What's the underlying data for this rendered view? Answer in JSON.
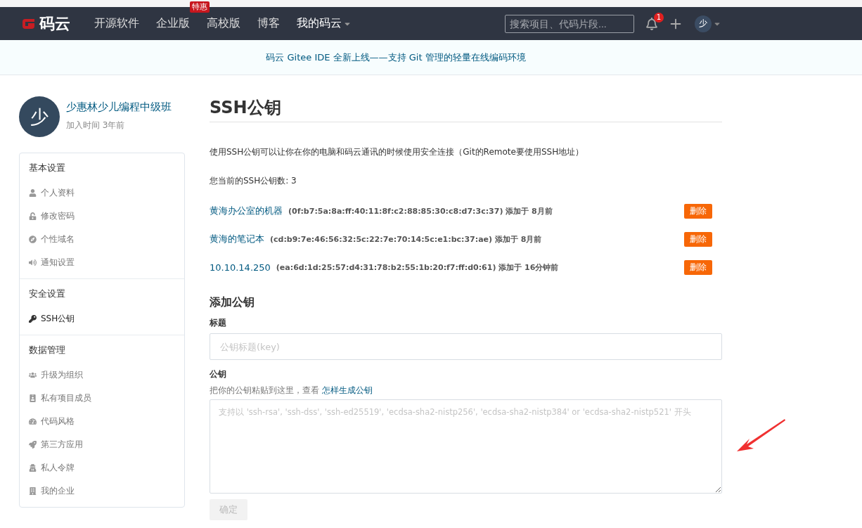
{
  "navbar": {
    "logo_text": "码云",
    "links": [
      {
        "label": "开源软件"
      },
      {
        "label": "企业版",
        "badge": "特惠"
      },
      {
        "label": "高校版"
      },
      {
        "label": "博客"
      }
    ],
    "my_menu": {
      "label": "我的码云"
    },
    "search": {
      "placeholder": "搜索项目、代码片段..."
    },
    "notification_count": "1",
    "avatar_text": "少"
  },
  "banner": {
    "text": "码云 Gitee IDE 全新上线——支持 Git 管理的轻量在线编码环境"
  },
  "profile": {
    "avatar_text": "少",
    "name": "少惠林少儿编程中级班",
    "joined": "加入时间 3年前"
  },
  "sidebar": {
    "sections": [
      {
        "title": "基本设置",
        "items": [
          {
            "label": "个人资料",
            "selected": false
          },
          {
            "label": "修改密码",
            "selected": false
          },
          {
            "label": "个性域名",
            "selected": false
          },
          {
            "label": "通知设置",
            "selected": false
          }
        ]
      },
      {
        "title": "安全设置",
        "items": [
          {
            "label": "SSH公钥",
            "selected": true
          }
        ]
      },
      {
        "title": "数据管理",
        "items": [
          {
            "label": "升级为组织",
            "selected": false
          },
          {
            "label": "私有项目成员",
            "selected": false
          },
          {
            "label": "代码风格",
            "selected": false
          },
          {
            "label": "第三方应用",
            "selected": false
          },
          {
            "label": "私人令牌",
            "selected": false
          },
          {
            "label": "我的企业",
            "selected": false
          }
        ]
      }
    ]
  },
  "main": {
    "title": "SSH公钥",
    "description": "使用SSH公钥可以让你在你的电脑和码云通讯的时候使用安全连接（Git的Remote要使用SSH地址）",
    "count_text": "您当前的SSH公钥数: 3",
    "keys": [
      {
        "name": "黄海办公室的机器",
        "fingerprint": "(0f:b7:5a:8a:ff:40:11:8f:c2:88:85:30:c8:d7:3c:37) 添加于 8月前",
        "delete_label": "删除"
      },
      {
        "name": "黄海的笔记本",
        "fingerprint": "(cd:b9:7e:46:56:32:5c:22:7e:70:14:5c:e1:bc:37:ae) 添加于 8月前",
        "delete_label": "删除"
      },
      {
        "name": "10.10.14.250",
        "fingerprint": "(ea:6d:1d:25:57:d4:31:78:b2:55:1b:20:f7:ff:d0:61) 添加于 16分钟前",
        "delete_label": "删除"
      }
    ],
    "add": {
      "title": "添加公钥",
      "title_label": "标题",
      "title_placeholder": "公钥标题(key)",
      "key_label": "公钥",
      "key_hint": "把你的公钥粘贴到这里，查看",
      "key_hint_link": "怎样生成公钥",
      "key_placeholder": "支持以 'ssh-rsa', 'ssh-dss', 'ssh-ed25519', 'ecdsa-sha2-nistp256', 'ecdsa-sha2-nistp384' or 'ecdsa-sha2-nistp521' 开头",
      "submit_label": "确定",
      "submit_disabled": true
    }
  }
}
